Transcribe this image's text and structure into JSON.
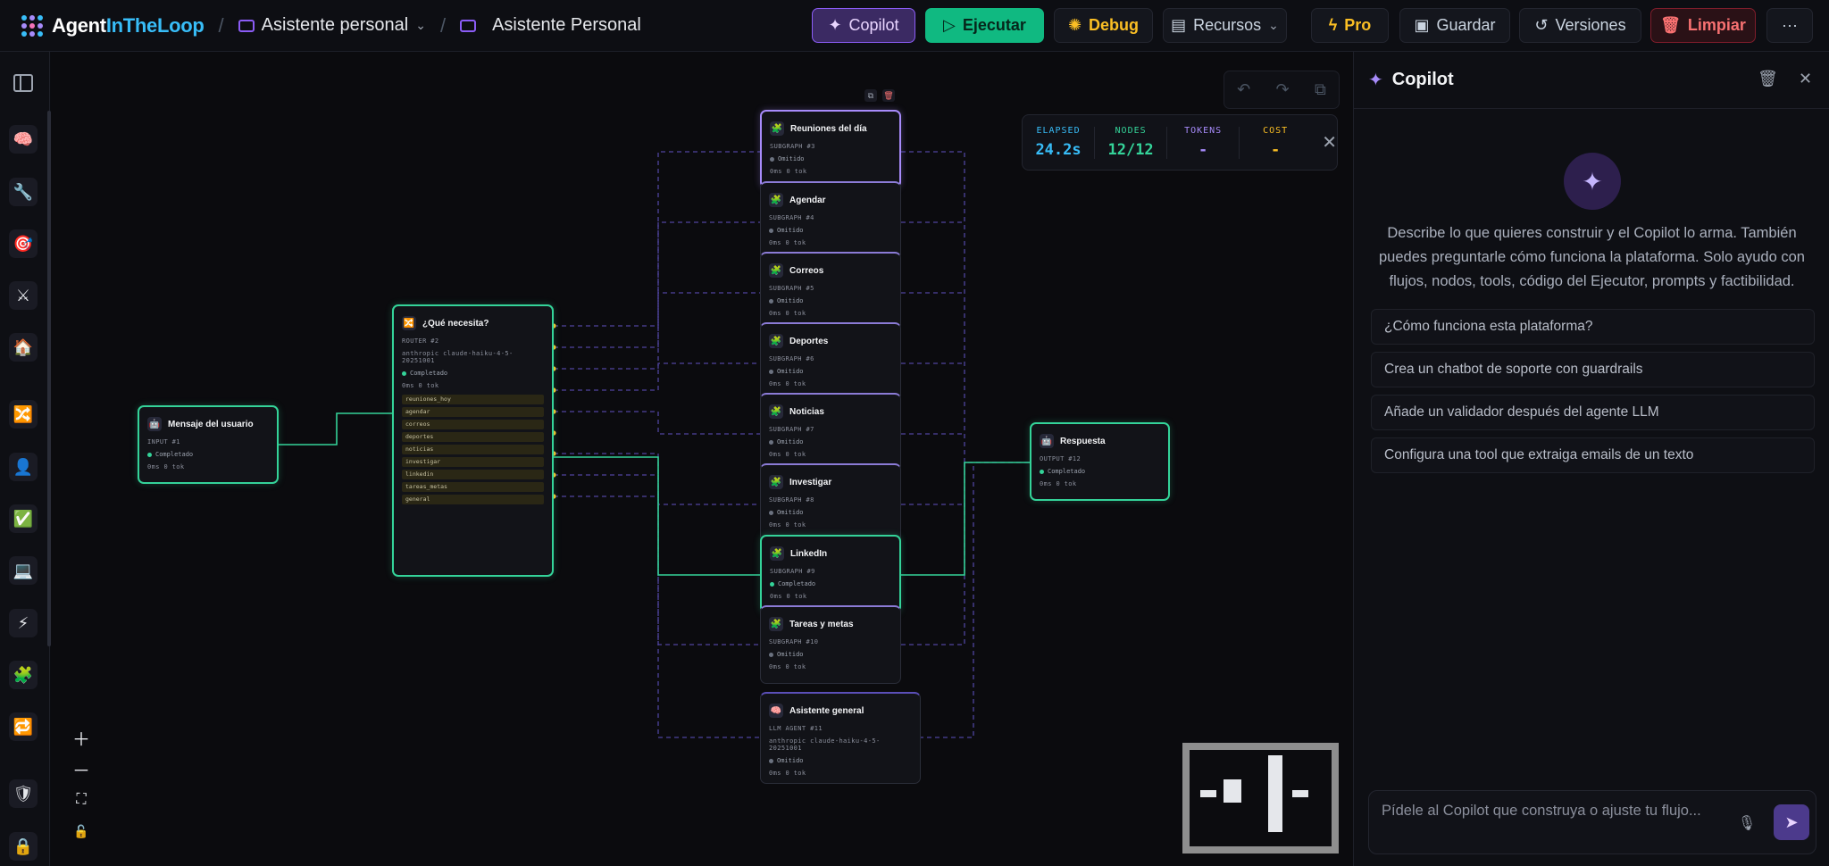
{
  "app": {
    "brand_main": "Agent",
    "brand_accent": "InTheLoop",
    "breadcrumb_project": "Asistente personal",
    "breadcrumb_flow": "Asistente Personal"
  },
  "toolbar": {
    "copilot": "Copilot",
    "run": "Ejecutar",
    "debug": "Debug",
    "resources": "Recursos",
    "pro": "Pro",
    "save": "Guardar",
    "versions": "Versiones",
    "clear": "Limpiar",
    "more": "···"
  },
  "colors": {
    "accent_purple": "#8b5cf6",
    "run_green": "#10b981",
    "warning_amber": "#fbbf24",
    "danger_red": "#f87171",
    "node_ok": "#34d399"
  },
  "stats": {
    "elapsed_label": "ELAPSED",
    "elapsed": "24.2s",
    "nodes_label": "NODES",
    "nodes": "12/12",
    "tokens_label": "TOKENS",
    "tokens": "-",
    "cost_label": "COST",
    "cost": "-"
  },
  "nodes": {
    "input": {
      "title": "Mensaje del usuario",
      "type": "INPUT  #1",
      "status": "Completado",
      "metrics": "0ms  0 tok"
    },
    "router": {
      "title": "¿Qué necesita?",
      "type": "ROUTER  #2",
      "model": "anthropic   claude-haiku-4-5-20251001",
      "status": "Completado",
      "metrics": "0ms  0 tok",
      "routes": [
        "reuniones_hoy",
        "agendar",
        "correos",
        "deportes",
        "noticias",
        "investigar",
        "linkedin",
        "tareas_metas",
        "general"
      ]
    },
    "subgraphs": [
      {
        "title": "Reuniones del día",
        "type": "SUBGRAPH  #3",
        "status": "Omitido",
        "metrics": "0ms  0 tok"
      },
      {
        "title": "Agendar",
        "type": "SUBGRAPH  #4",
        "status": "Omitido",
        "metrics": "0ms  0 tok"
      },
      {
        "title": "Correos",
        "type": "SUBGRAPH  #5",
        "status": "Omitido",
        "metrics": "0ms  0 tok"
      },
      {
        "title": "Deportes",
        "type": "SUBGRAPH  #6",
        "status": "Omitido",
        "metrics": "0ms  0 tok"
      },
      {
        "title": "Noticias",
        "type": "SUBGRAPH  #7",
        "status": "Omitido",
        "metrics": "0ms  0 tok"
      },
      {
        "title": "Investigar",
        "type": "SUBGRAPH  #8",
        "status": "Omitido",
        "metrics": "0ms  0 tok"
      },
      {
        "title": "LinkedIn",
        "type": "SUBGRAPH  #9",
        "status": "Completado",
        "metrics": "0ms  0 tok"
      },
      {
        "title": "Tareas y metas",
        "type": "SUBGRAPH  #10",
        "status": "Omitido",
        "metrics": "0ms  0 tok"
      }
    ],
    "general": {
      "title": "Asistente general",
      "type": "LLM AGENT  #11",
      "model": "anthropic   claude-haiku-4-5-20251001",
      "status": "Omitido",
      "metrics": "0ms  0 tok"
    },
    "output": {
      "title": "Respuesta",
      "type": "OUTPUT  #12",
      "status": "Completado",
      "metrics": "0ms  0 tok"
    }
  },
  "copilot": {
    "title": "Copilot",
    "intro": "Describe lo que quieres construir y el Copilot lo arma. También puedes preguntarle cómo funciona la plataforma. Solo ayudo con flujos, nodos, tools, código del Ejecutor, prompts y factibilidad.",
    "suggestions": [
      "¿Cómo funciona esta plataforma?",
      "Crea un chatbot de soporte con guardrails",
      "Añade un validador después del agente LLM",
      "Configura una tool que extraiga emails de un texto"
    ],
    "input_placeholder": "Pídele al Copilot que construya o ajuste tu flujo..."
  }
}
